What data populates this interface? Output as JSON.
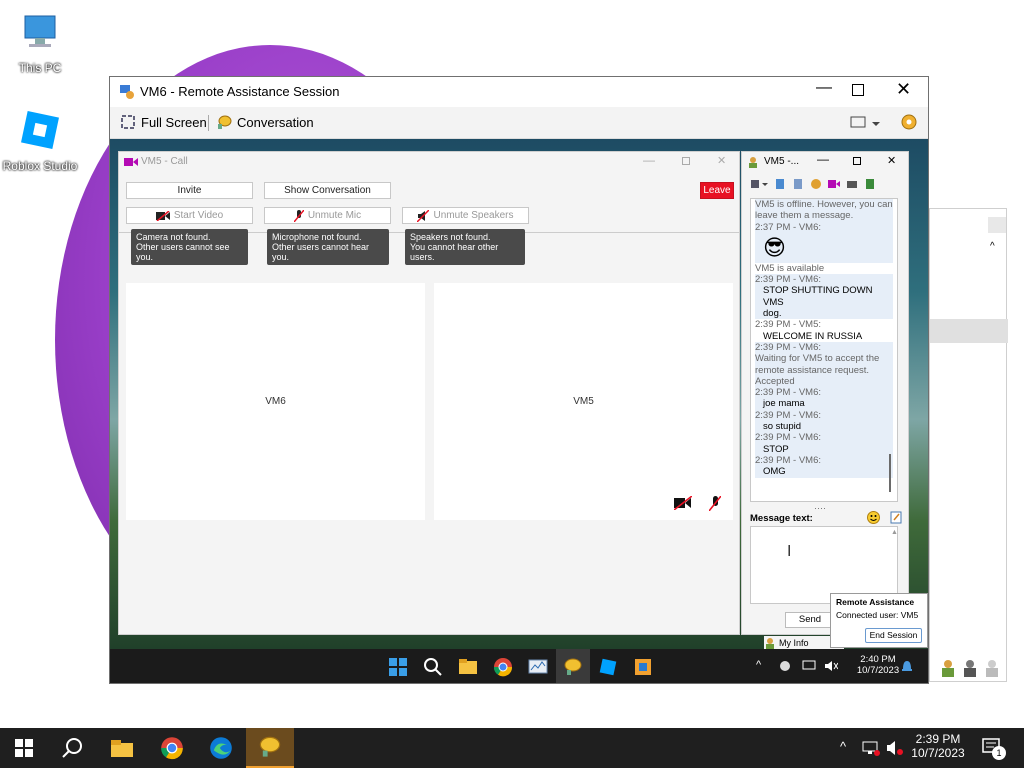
{
  "desktop": {
    "icons": [
      {
        "label": "This PC",
        "icon": "monitor-icon"
      },
      {
        "label": "Roblox Studio",
        "icon": "roblox-studio-icon"
      }
    ]
  },
  "vm_window": {
    "title": "VM6 - Remote Assistance Session",
    "toolbar": {
      "fullscreen_label": "Full Screen",
      "conversation_label": "Conversation"
    }
  },
  "call": {
    "title": "VM5 - Call",
    "invite": "Invite",
    "show_conversation": "Show Conversation",
    "leave": "Leave",
    "start_video": "Start Video",
    "unmute_mic": "Unmute Mic",
    "unmute_speakers": "Unmute Speakers",
    "tips": {
      "camera_l1": "Camera not found.",
      "camera_l2": "Other users cannot see you.",
      "mic_l1": "Microphone not found.",
      "mic_l2": "Other users cannot hear you.",
      "spk_l1": "Speakers not found.",
      "spk_l2": "You cannot hear other users."
    },
    "pane_left": "VM6",
    "pane_right": "VM5"
  },
  "chat": {
    "title": "VM5 -...",
    "log": [
      {
        "t": "VM5 is offline. However, you can leave them a message.",
        "cls": "meta hl"
      },
      {
        "t": "2:37 PM - VM6:",
        "cls": "meta hl"
      },
      {
        "t": "😎",
        "cls": "msg hl emoji"
      },
      {
        "t": "VM5 is available",
        "cls": "meta"
      },
      {
        "t": "2:39 PM - VM6:",
        "cls": "meta hl"
      },
      {
        "t": "STOP SHUTTING DOWN VMS",
        "cls": "msg hl"
      },
      {
        "t": "dog.",
        "cls": "msg hl"
      },
      {
        "t": "2:39 PM - VM5:",
        "cls": "meta"
      },
      {
        "t": "WELCOME IN RUSSIA",
        "cls": "msg"
      },
      {
        "t": "2:39 PM - VM6:",
        "cls": "meta hl"
      },
      {
        "t": "Waiting for VM5 to accept the remote assistance request. Accepted",
        "cls": "meta hl"
      },
      {
        "t": "2:39 PM - VM6:",
        "cls": "meta hl"
      },
      {
        "t": "joe mama",
        "cls": "msg hl"
      },
      {
        "t": "2:39 PM - VM6:",
        "cls": "meta hl"
      },
      {
        "t": "so stupid",
        "cls": "msg hl"
      },
      {
        "t": "2:39 PM - VM6:",
        "cls": "meta hl"
      },
      {
        "t": "STOP",
        "cls": "msg hl"
      },
      {
        "t": "2:39 PM - VM6:",
        "cls": "meta hl"
      },
      {
        "t": "OMG",
        "cls": "msg hl"
      }
    ],
    "message_label": "Message text:",
    "send": "Send",
    "my_info": "My Info"
  },
  "ra_popup": {
    "title": "Remote Assistance",
    "connected": "Connected user: VM5",
    "end": "End Session"
  },
  "guest_taskbar": {
    "time": "2:40 PM",
    "date": "10/7/2023"
  },
  "host_taskbar": {
    "time": "2:39 PM",
    "date": "10/7/2023",
    "notif_count": "1"
  },
  "colors": {
    "leave_red": "#e81123",
    "taskbar": "#1f1f1f",
    "accent": "#0078d4"
  }
}
